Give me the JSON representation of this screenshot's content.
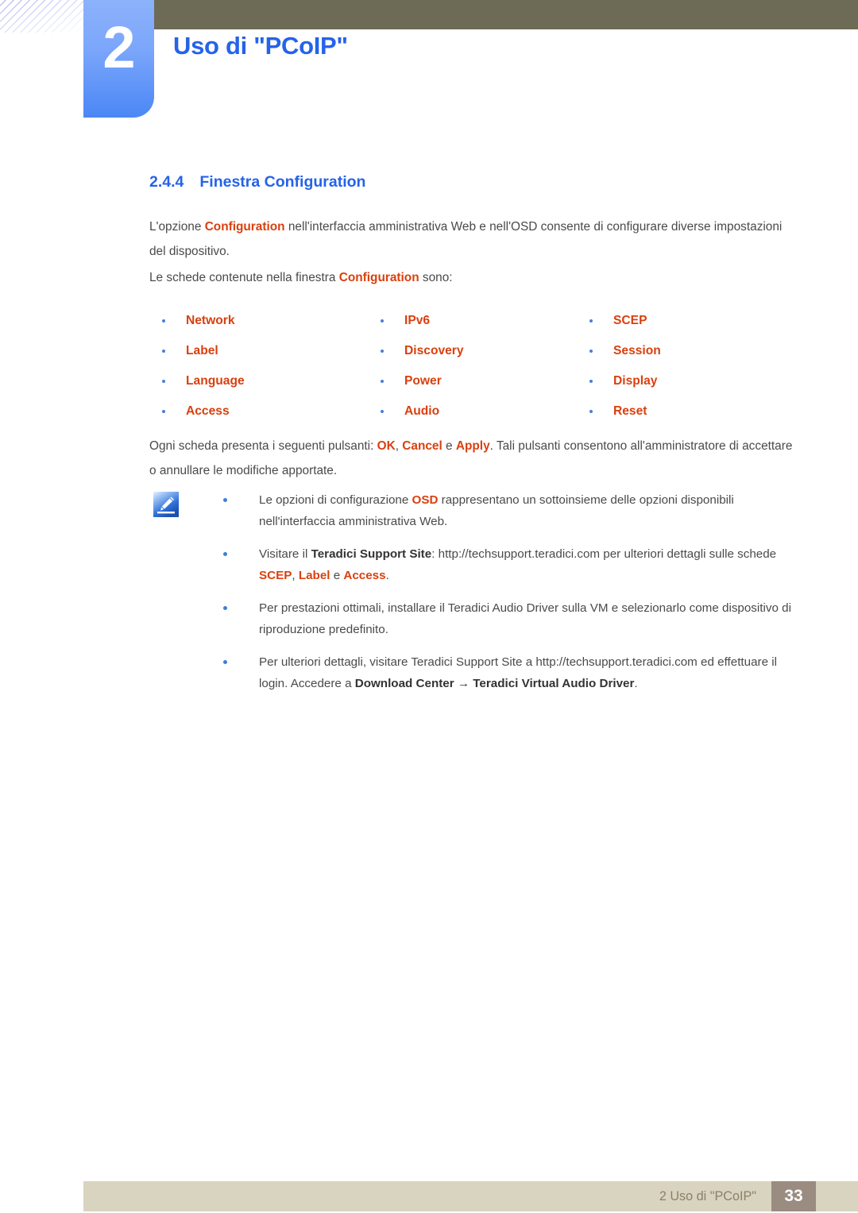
{
  "header": {
    "chapter_number": "2",
    "chapter_title": "Uso di \"PCoIP\"",
    "accent_blue": "#2563e8",
    "badge_blue": "#7ba6fb",
    "bar_olive": "#6d6b56"
  },
  "section": {
    "number": "2.4.4",
    "title": "Finestra Configuration"
  },
  "paragraphs": {
    "intro_1": "L'opzione ",
    "intro_strong": "Configuration",
    "intro_2": " nell'interfaccia amministrativa Web e nell'OSD consente di configurare diverse impostazioni del dispositivo.",
    "tabs_1": "Le schede contenute nella finestra ",
    "tabs_strong": "Configuration",
    "tabs_2": " sono:",
    "buttons_1": "Ogni scheda presenta i seguenti pulsanti: ",
    "buttons_ok": "OK",
    "buttons_sep1": ", ",
    "buttons_cancel": "Cancel",
    "buttons_sep2": " e ",
    "buttons_apply": "Apply",
    "buttons_2": ". Tali pulsanti consentono all'amministratore di accettare o annullare le modifiche apportate."
  },
  "tab_list": {
    "accent": "#d9400f",
    "bullet_color": "#4a7fd6",
    "columns": [
      {
        "items": [
          "Network",
          "Label",
          "Language",
          "Access"
        ]
      },
      {
        "items": [
          "IPv6",
          "Discovery",
          "Power",
          "Audio"
        ]
      },
      {
        "items": [
          "SCEP",
          "Session",
          "Display",
          "Reset"
        ]
      }
    ]
  },
  "note": {
    "icon": "note-pencil-icon",
    "items": [
      {
        "p1": "Le opzioni di configurazione ",
        "s1": "OSD",
        "p2": " rappresentano un sottoinsieme delle opzioni disponibili nell'interfaccia amministrativa Web.",
        "s2": "",
        "p3": "",
        "s3": "",
        "p4": "",
        "s4": "",
        "p5": ""
      },
      {
        "p1": "Visitare il ",
        "s1": "Teradici Support Site",
        "p2": ": http://techsupport.teradici.com per ulteriori dettagli sulle schede ",
        "s2": "SCEP",
        "p3": ", ",
        "s3": "Label",
        "p4": " e ",
        "s4": "Access",
        "p5": "."
      },
      {
        "p1": "Per prestazioni ottimali, installare il Teradici Audio Driver sulla VM e selezionarlo come dispositivo di riproduzione predefinito.",
        "s1": "",
        "p2": "",
        "s2": "",
        "p3": "",
        "s3": "",
        "p4": "",
        "s4": "",
        "p5": ""
      },
      {
        "p1": "Per ulteriori dettagli, visitare Teradici Support Site a http://techsupport.teradici.com ed effettuare il login. Accedere a ",
        "s1": "Download Center → Teradici Virtual Audio Driver",
        "p2": ".",
        "s2": "",
        "p3": "",
        "s3": "",
        "p4": "",
        "s4": "",
        "p5": ""
      }
    ]
  },
  "footer": {
    "text": "2 Uso di \"PCoIP\"",
    "page_number": "33",
    "bar_color": "#d8d4c0",
    "page_box_color": "#9a8c80"
  }
}
